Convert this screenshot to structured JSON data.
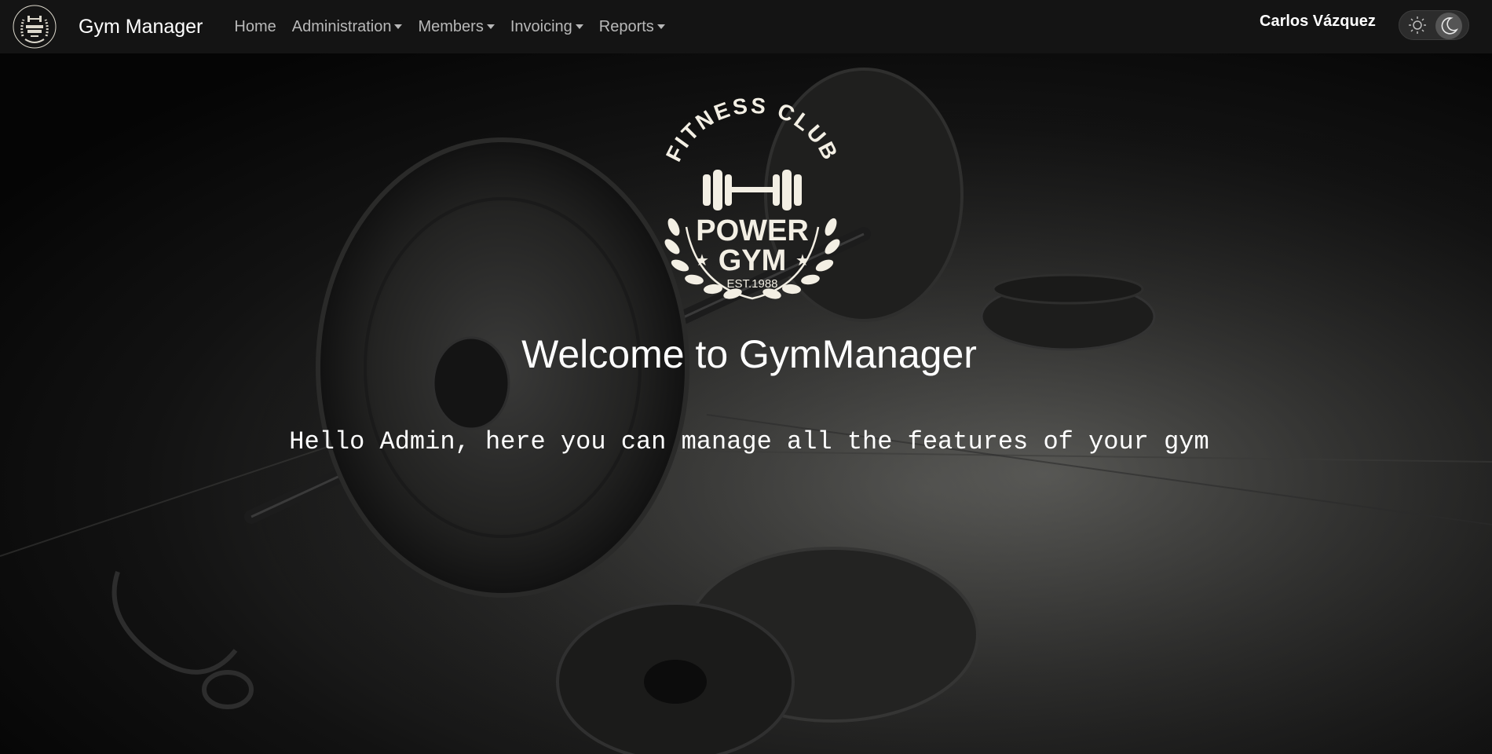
{
  "navbar": {
    "brand": "Gym Manager",
    "items": [
      {
        "label": "Home",
        "dropdown": false
      },
      {
        "label": "Administration",
        "dropdown": true
      },
      {
        "label": "Members",
        "dropdown": true
      },
      {
        "label": "Invoicing",
        "dropdown": true
      },
      {
        "label": "Reports",
        "dropdown": true
      }
    ],
    "user_name": "Carlos Vázquez",
    "theme_toggle": {
      "left_icon": "sun-icon",
      "right_icon": "moon-icon",
      "selected": "dark"
    }
  },
  "logo": {
    "arc_text": "FITNESS CLUB",
    "line1": "POWER",
    "line2": "GYM",
    "est": "EST.1988"
  },
  "hero": {
    "title": "Welcome to GymManager",
    "subtitle": "Hello Admin, here you can manage all the features of your gym"
  },
  "colors": {
    "navbar_bg": "#141414",
    "nav_text": "#b8b8b8",
    "logo_cream": "#f3efe4",
    "hero_text": "#ffffff"
  }
}
